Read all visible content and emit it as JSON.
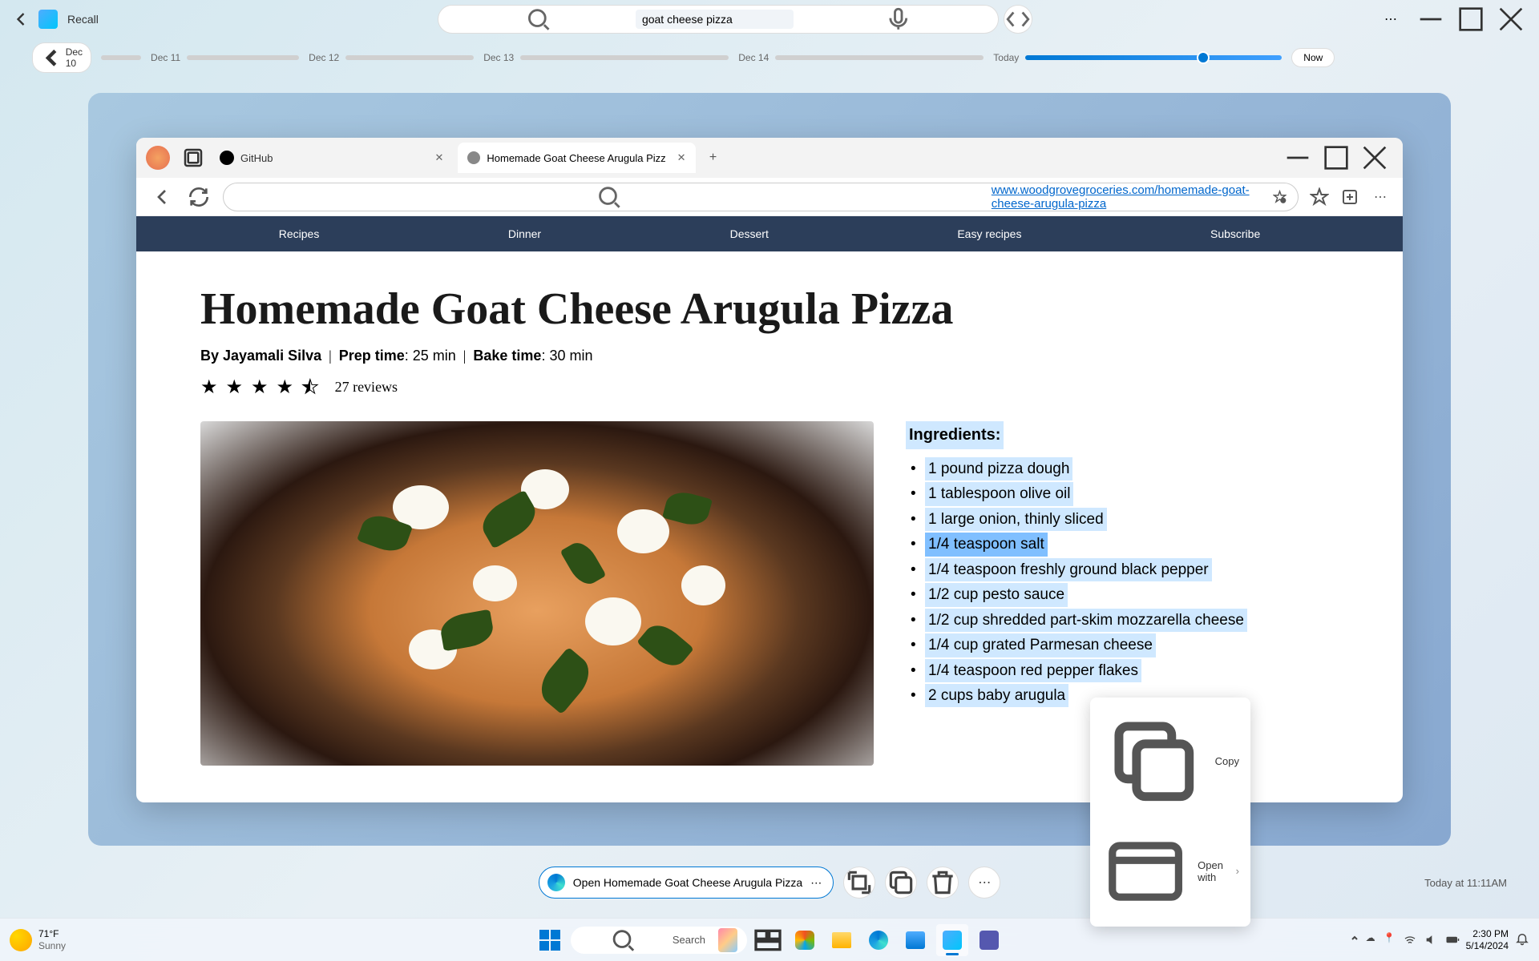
{
  "app": {
    "name": "Recall"
  },
  "search": {
    "value": "goat cheese pizza"
  },
  "timeline": {
    "back": "Dec 10",
    "dates": [
      "Dec 11",
      "Dec 12",
      "Dec 13",
      "Dec 14"
    ],
    "today": "Today",
    "now": "Now"
  },
  "browser": {
    "tabs": [
      {
        "label": "GitHub"
      },
      {
        "label": "Homemade Goat Cheese Arugula Pizz"
      }
    ],
    "url": "www.woodgrovegroceries.com/homemade-goat-cheese-arugula-pizza"
  },
  "nav": [
    "Recipes",
    "Dinner",
    "Dessert",
    "Easy recipes",
    "Subscribe"
  ],
  "recipe": {
    "title": "Homemade Goat Cheese Arugula Pizza",
    "byline_author": "By Jayamali Silva",
    "prep_label": "Prep time",
    "prep_value": ": 25 min",
    "bake_label": "Bake time",
    "bake_value": ": 30 min",
    "reviews": "27 reviews",
    "ingredients_title": "Ingredients:",
    "ingredients": [
      "1 pound pizza dough",
      "1 tablespoon olive oil",
      "1 large onion, thinly sliced",
      "1/4 teaspoon salt",
      "1/4 teaspoon freshly ground black pepper",
      "1/2 cup pesto sauce",
      "1/2 cup shredded part-skim mozzarella cheese",
      "1/4 cup grated Parmesan cheese",
      "1/4 teaspoon red pepper flakes",
      "2 cups baby arugula"
    ]
  },
  "ctx": {
    "copy": "Copy",
    "openwith": "Open with"
  },
  "action": {
    "open": "Open Homemade Goat Cheese Arugula Pizza",
    "timestamp": "Today at 11:11AM"
  },
  "taskbar": {
    "temp": "71°F",
    "cond": "Sunny",
    "search": "Search",
    "time": "2:30 PM",
    "date": "5/14/2024"
  }
}
